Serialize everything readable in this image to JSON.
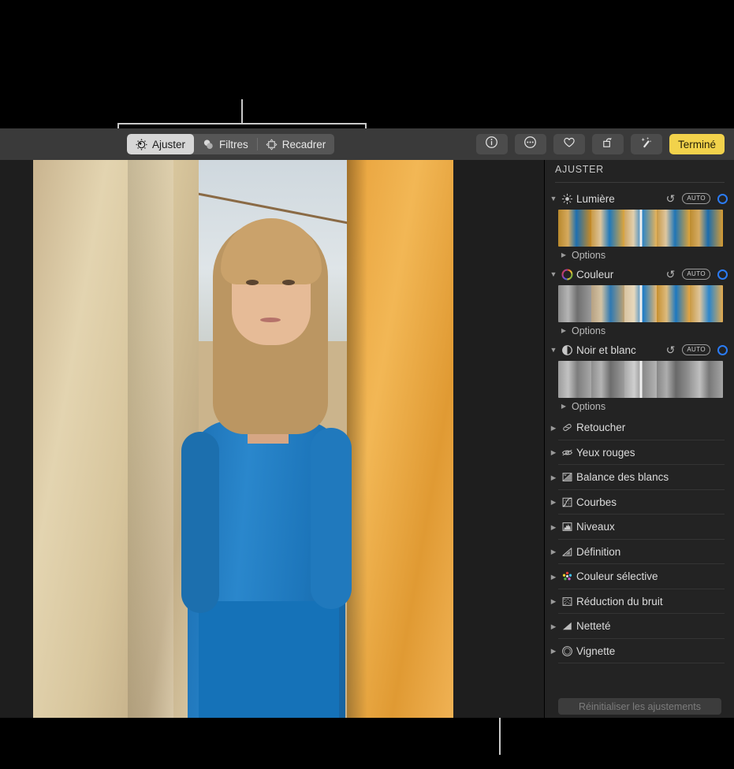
{
  "toolbar": {
    "modes": [
      {
        "label": "Ajuster",
        "icon": "adjust-dial-icon",
        "active": true
      },
      {
        "label": "Filtres",
        "icon": "filters-circles-icon",
        "active": false
      },
      {
        "label": "Recadrer",
        "icon": "crop-icon",
        "active": false
      }
    ],
    "right_buttons": [
      {
        "name": "info-button",
        "icon": "info-circle-icon"
      },
      {
        "name": "more-button",
        "icon": "ellipsis-circle-icon"
      },
      {
        "name": "favorite-button",
        "icon": "heart-icon"
      },
      {
        "name": "rotate-button",
        "icon": "rotate-icon"
      },
      {
        "name": "auto-enhance-button",
        "icon": "magic-wand-icon"
      }
    ],
    "done_label": "Terminé"
  },
  "sidebar": {
    "title": "AJUSTER",
    "auto_label": "AUTO",
    "options_label": "Options",
    "groups": [
      {
        "label": "Lumière",
        "icon": "sun-icon",
        "expanded": true,
        "has_reset": true,
        "has_auto": true,
        "has_toggle": true,
        "strip": "light-variations-strip",
        "thumbs": [
          "#c98a23",
          "#d99a30",
          "#cf9a3d",
          "#e0a63a",
          "#d8a03a"
        ]
      },
      {
        "label": "Couleur",
        "icon": "color-wheel-icon",
        "expanded": true,
        "has_reset": true,
        "has_auto": true,
        "has_toggle": true,
        "strip": "color-variations-strip",
        "thumbs": [
          "#8e8e8e",
          "#b9a68c",
          "#d8c3a0",
          "#e8a94a",
          "#e0a352"
        ]
      },
      {
        "label": "Noir et blanc",
        "icon": "half-circle-icon",
        "expanded": true,
        "has_reset": true,
        "has_auto": true,
        "has_toggle": true,
        "strip": "bw-variations-strip",
        "thumbs": [
          "#a5a5a5",
          "#9a9a9a",
          "#b0b0b0",
          "#8f8f8f",
          "#a0a0a0"
        ]
      }
    ],
    "rows": [
      {
        "label": "Retoucher",
        "icon": "bandage-icon"
      },
      {
        "label": "Yeux rouges",
        "icon": "red-eye-icon"
      },
      {
        "label": "Balance des blancs",
        "icon": "white-balance-icon"
      },
      {
        "label": "Courbes",
        "icon": "curves-icon"
      },
      {
        "label": "Niveaux",
        "icon": "levels-icon"
      },
      {
        "label": "Définition",
        "icon": "definition-icon"
      },
      {
        "label": "Couleur sélective",
        "icon": "selective-color-icon"
      },
      {
        "label": "Réduction du bruit",
        "icon": "noise-reduction-icon"
      },
      {
        "label": "Netteté",
        "icon": "sharpness-icon"
      },
      {
        "label": "Vignette",
        "icon": "vignette-icon"
      }
    ],
    "reset_button_label": "Réinitialiser les ajustements"
  },
  "colors": {
    "accent_yellow": "#f2d24b",
    "toggle_blue": "#2b7cf6",
    "toolbar_bg": "#3a3a3a",
    "sidebar_bg": "#232323",
    "canvas_bg": "#1e1e1e",
    "callout_line": "#c9c9c9"
  },
  "photo": {
    "description": "Portrait d'une femme blonde en robe bleue entre des draps beige et orange"
  }
}
